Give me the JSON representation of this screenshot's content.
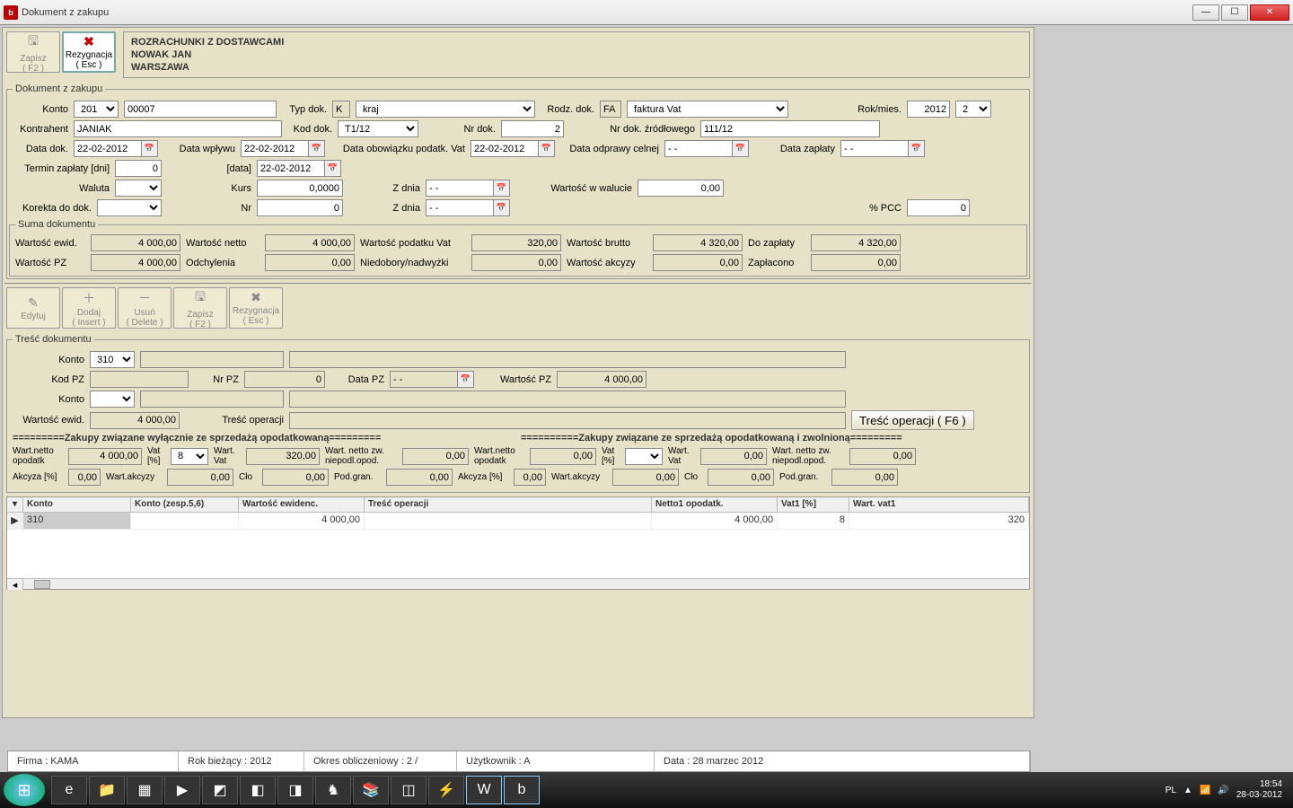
{
  "window": {
    "title": "Dokument z zakupu"
  },
  "toolbar1": {
    "save": "Zapisz",
    "save_key": "( F2 )",
    "cancel": "Rezygnacja",
    "cancel_key": "( Esc )"
  },
  "supplier": {
    "line1": "ROZRACHUNKI Z DOSTAWCAMI",
    "line2": "NOWAK JAN",
    "line3": "WARSZAWA"
  },
  "doc": {
    "legend": "Dokument z zakupu",
    "konto_lbl": "Konto",
    "konto": "201",
    "konto_num": "00007",
    "typdok_lbl": "Typ dok.",
    "typdok_code": "K",
    "typdok": "kraj",
    "rodzdok_lbl": "Rodz. dok.",
    "rodzdok_code": "FA",
    "rodzdok": "faktura Vat",
    "rokmies_lbl": "Rok/mies.",
    "rok": "2012",
    "mies": "2",
    "kontrahent_lbl": "Kontrahent",
    "kontrahent": "JANIAK",
    "koddok_lbl": "Kod dok.",
    "koddok": "T1/12",
    "nrdok_lbl": "Nr dok.",
    "nrdok": "2",
    "nrdokzr_lbl": "Nr dok. źródłowego",
    "nrdokzr": "111/12",
    "datadok_lbl": "Data dok.",
    "datadok": "22-02-2012",
    "datawpl_lbl": "Data wpływu",
    "datawpl": "22-02-2012",
    "dataobv_lbl": "Data obowiązku podatk. Vat",
    "dataobv": "22-02-2012",
    "dataodpr_lbl": "Data odprawy celnej",
    "dataodpr": "- -",
    "datazapl_lbl": "Data zapłaty",
    "datazapl": "- -",
    "termin_lbl": "Termin  zapłaty [dni]",
    "termin": "0",
    "data2_lbl": "[data]",
    "data2": "22-02-2012",
    "waluta_lbl": "Waluta",
    "waluta": "",
    "kurs_lbl": "Kurs",
    "kurs": "0,0000",
    "zdnia_lbl": "Z dnia",
    "zdnia": "- -",
    "wartwal_lbl": "Wartość w walucie",
    "wartwal": "0,00",
    "korekta_lbl": "Korekta do dok.",
    "korekta": "",
    "nr_lbl": "Nr",
    "nr": "0",
    "zdnia2_lbl": "Z dnia",
    "zdnia2": "- -",
    "pcc_lbl": "% PCC",
    "pcc": "0"
  },
  "sum": {
    "legend": "Suma dokumentu",
    "wartewid_lbl": "Wartość ewid.",
    "wartewid": "4 000,00",
    "wartnetto_lbl": "Wartość netto",
    "wartnetto": "4 000,00",
    "wartvat_lbl": "Wartość podatku Vat",
    "wartvat": "320,00",
    "wartbrutto_lbl": "Wartość brutto",
    "wartbrutto": "4 320,00",
    "dozapl_lbl": "Do zapłaty",
    "dozapl": "4 320,00",
    "wartpz_lbl": "Wartość PZ",
    "wartpz": "4 000,00",
    "odchyl_lbl": "Odchylenia",
    "odchyl": "0,00",
    "niedob_lbl": "Niedobory/nadwyżki",
    "niedob": "0,00",
    "wartakc_lbl": "Wartość akcyzy",
    "wartakc": "0,00",
    "zaplac_lbl": "Zapłacono",
    "zaplac": "0,00"
  },
  "toolbar2": {
    "edytuj": "Edytuj",
    "dodaj": "Dodaj",
    "dodaj_key": "( Insert )",
    "usun": "Usuń",
    "usun_key": "( Delete )",
    "zapisz": "Zapisz",
    "zapisz_key": "( F2 )",
    "rezyg": "Rezygnacja",
    "rezyg_key": "( Esc )"
  },
  "content": {
    "legend": "Treść dokumentu",
    "konto_lbl": "Konto",
    "konto": "310",
    "kodpz_lbl": "Kod PZ",
    "kodpz": "",
    "nrpz_lbl": "Nr PZ",
    "nrpz": "0",
    "datapz_lbl": "Data PZ",
    "datapz": "- -",
    "wartpz_lbl": "Wartość PZ",
    "wartpz": "4 000,00",
    "konto2_lbl": "Konto",
    "konto2": "",
    "wartewid_lbl": "Wartość ewid.",
    "wartewid": "4 000,00",
    "tresc_lbl": "Treść operacji",
    "tresc": "",
    "btn_tresc": "Treść operacji ( F6 )",
    "hdr1": "=========Zakupy związane wyłącznie ze sprzedażą opodatkowaną=========",
    "hdr2": "==========Zakupy związane ze sprzedażą opodatkowaną i zwolnioną=========",
    "wnetto_lbl": "Wart.netto opodatk",
    "wnetto": "4 000,00",
    "vatpct_lbl": "Vat [%]",
    "vatpct": "8",
    "wvat_lbl": "Wart. Vat",
    "wvat": "320,00",
    "wnettozw_lbl": "Wart. netto zw. niepodl.opod.",
    "wnettozw": "0,00",
    "wnetto2": "0,00",
    "vatpct2": "",
    "wvat2": "0,00",
    "wnettozw2": "0,00",
    "akcpct_lbl": "Akcyza [%]",
    "akcpct": "0,00",
    "wartakc_lbl": "Wart.akcyzy",
    "wartakc": "0,00",
    "clo_lbl": "Cło",
    "clo": "0,00",
    "podgran_lbl": "Pod.gran.",
    "podgran": "0,00",
    "akcpct2": "0,00",
    "wartakc2": "0,00",
    "clo2": "0,00",
    "podgran2": "0,00"
  },
  "grid": {
    "h": [
      "Konto",
      "Konto (zesp.5,6)",
      "Wartość ewidenc.",
      "Treść operacji",
      "Netto1 opodatk.",
      "Vat1 [%]",
      "Wart. vat1"
    ],
    "row": [
      "310",
      "",
      "4 000,00",
      "",
      "4 000,00",
      "8",
      "320"
    ]
  },
  "status": {
    "firma": "Firma : KAMA",
    "rok": "Rok bieżący : 2012",
    "okres": "Okres obliczeniowy : 2 /",
    "user": "Użytkownik : A",
    "data": "Data : 28 marzec 2012"
  },
  "tray": {
    "lang": "PL",
    "time": "18:54",
    "date": "28-03-2012"
  }
}
